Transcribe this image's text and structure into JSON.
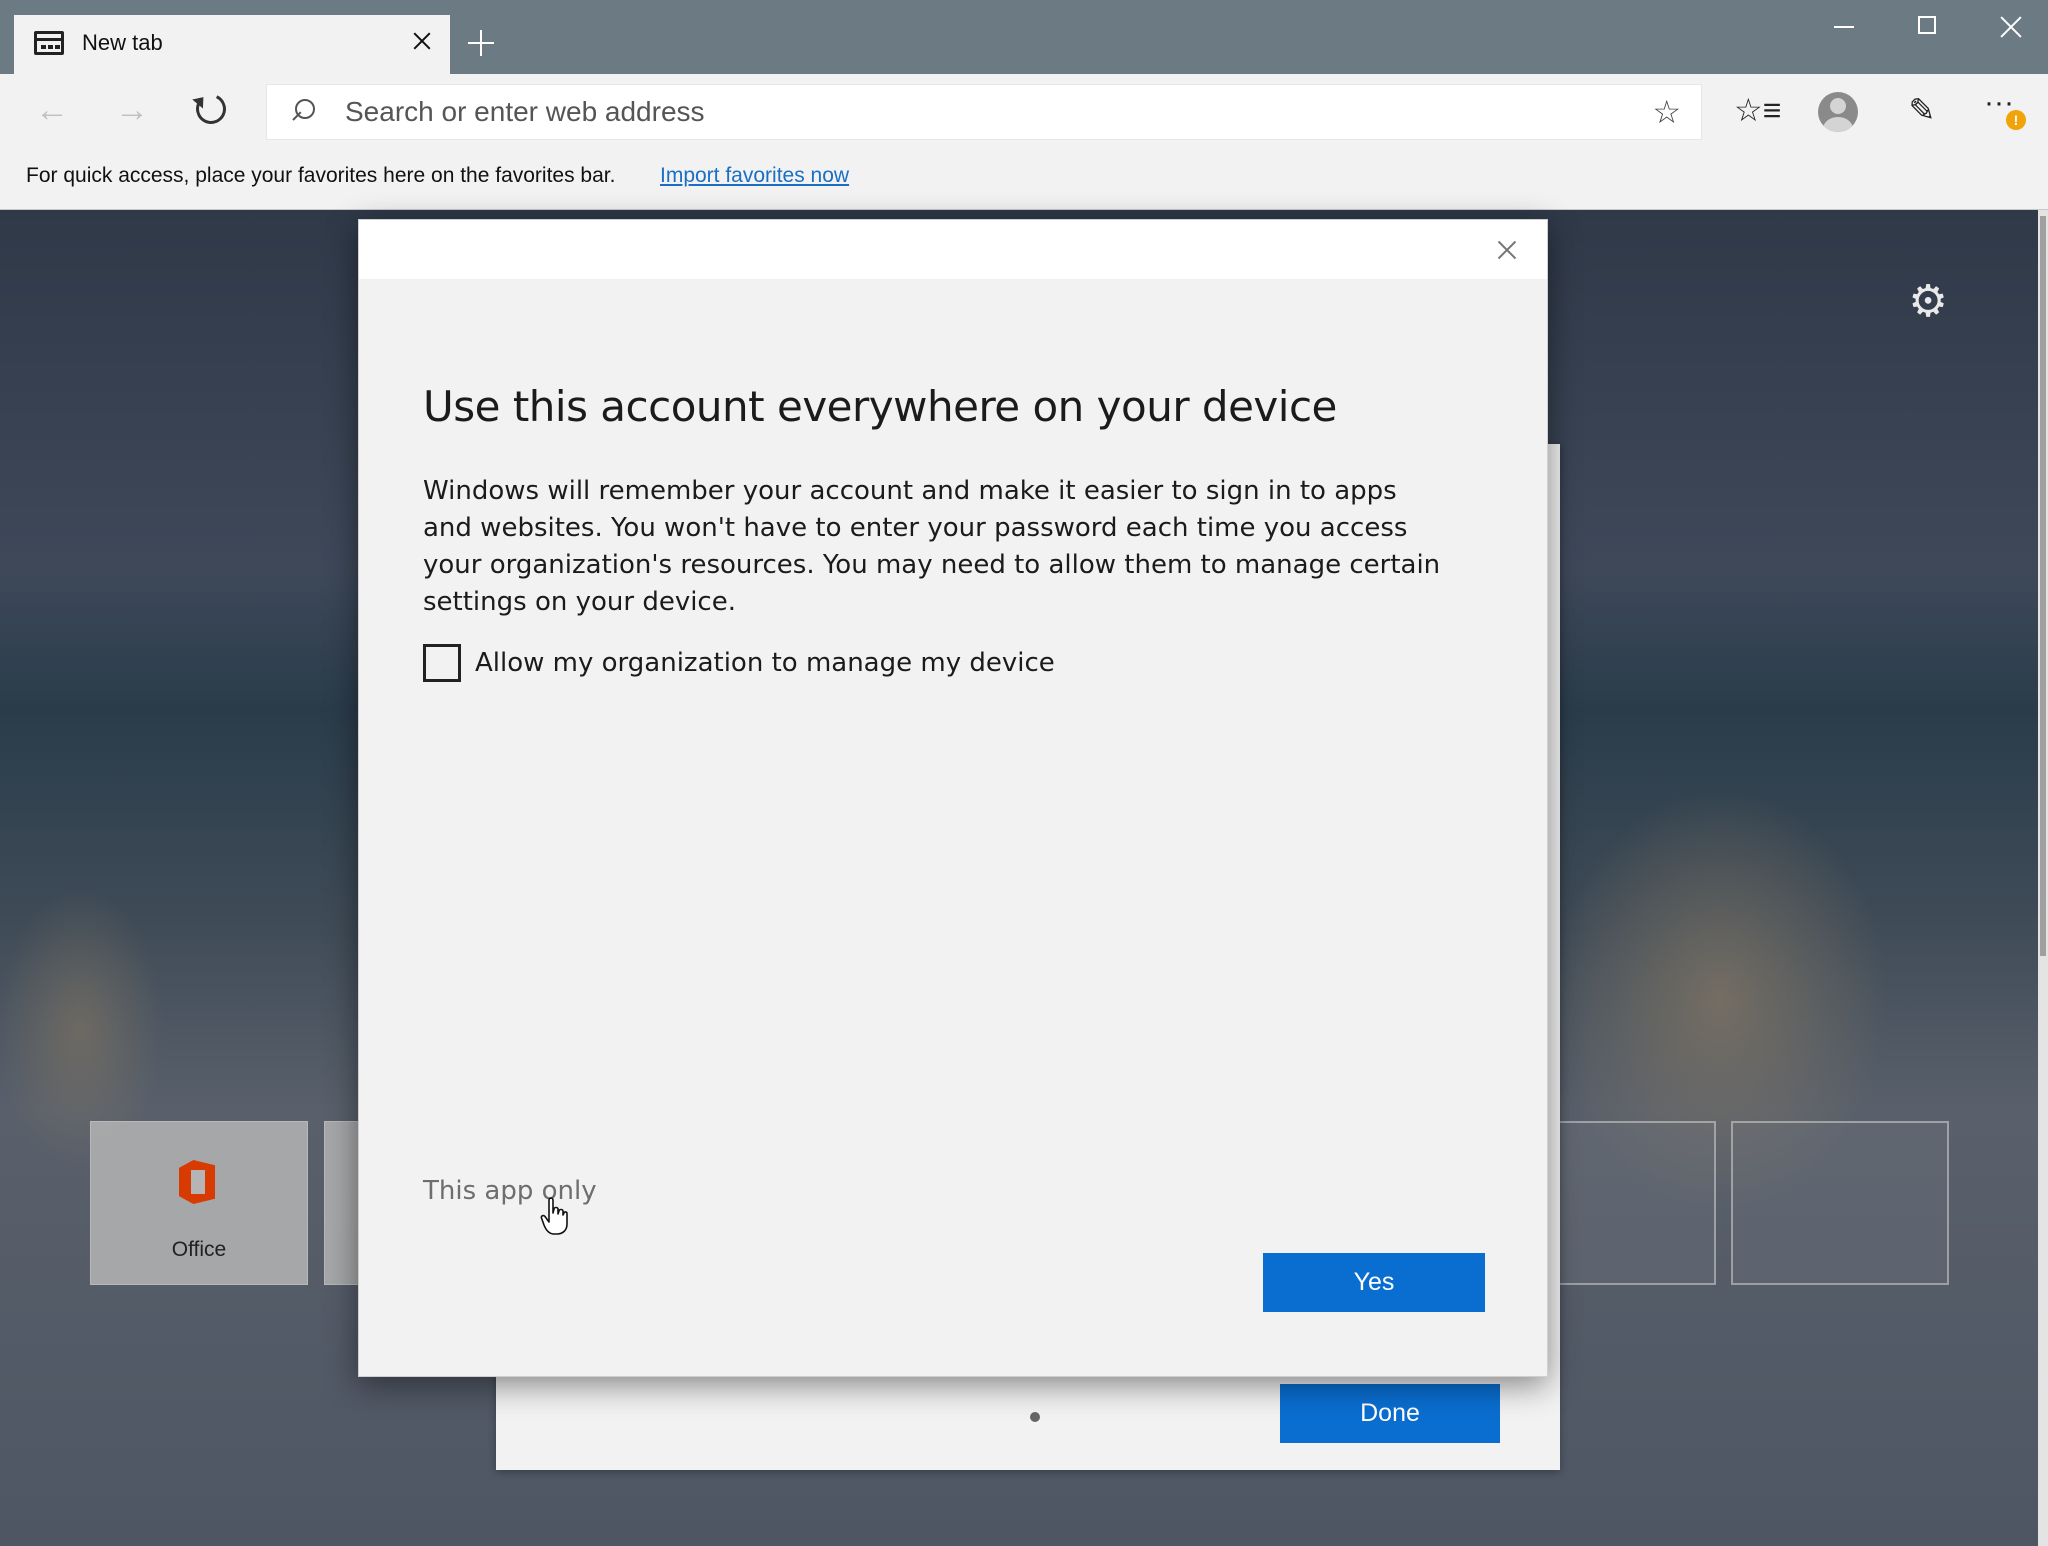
{
  "browser": {
    "tab": {
      "title": "New tab"
    },
    "address_bar": {
      "placeholder": "Search or enter web address"
    },
    "favorites_bar": {
      "message": "For quick access, place your favorites here on the favorites bar.",
      "import_link": "Import favorites now"
    },
    "icons": {
      "tab": "tab-page-icon",
      "back": "back-arrow-icon",
      "forward": "forward-arrow-icon",
      "refresh": "refresh-icon",
      "favorites": "favorites-list-icon",
      "profile": "profile-avatar-icon",
      "share": "share-feedback-icon",
      "more": "more-options-icon",
      "warning": "warning-badge-icon"
    },
    "warning_badge": "!"
  },
  "new_tab_page": {
    "tiles": [
      {
        "label": "Office",
        "icon": "office-icon"
      },
      {
        "label": ""
      },
      {
        "label": ""
      },
      {
        "label": ""
      }
    ],
    "done_button": "Done"
  },
  "dialog": {
    "title": "Use this account everywhere on your device",
    "body": "Windows will remember your account and make it easier to sign in to apps and websites. You won't have to enter your password each time you access your organization's resources. You may need to allow them to manage certain settings on your device.",
    "checkbox_label": "Allow my organization to manage my device",
    "checkbox_checked": false,
    "secondary_link": "This app only",
    "primary_button": "Yes"
  },
  "colors": {
    "accent": "#0a6ed1",
    "link": "#1a6fc4",
    "titlebar": "#6b7a83",
    "office": "#d83b01",
    "badge": "#f0a30a"
  }
}
